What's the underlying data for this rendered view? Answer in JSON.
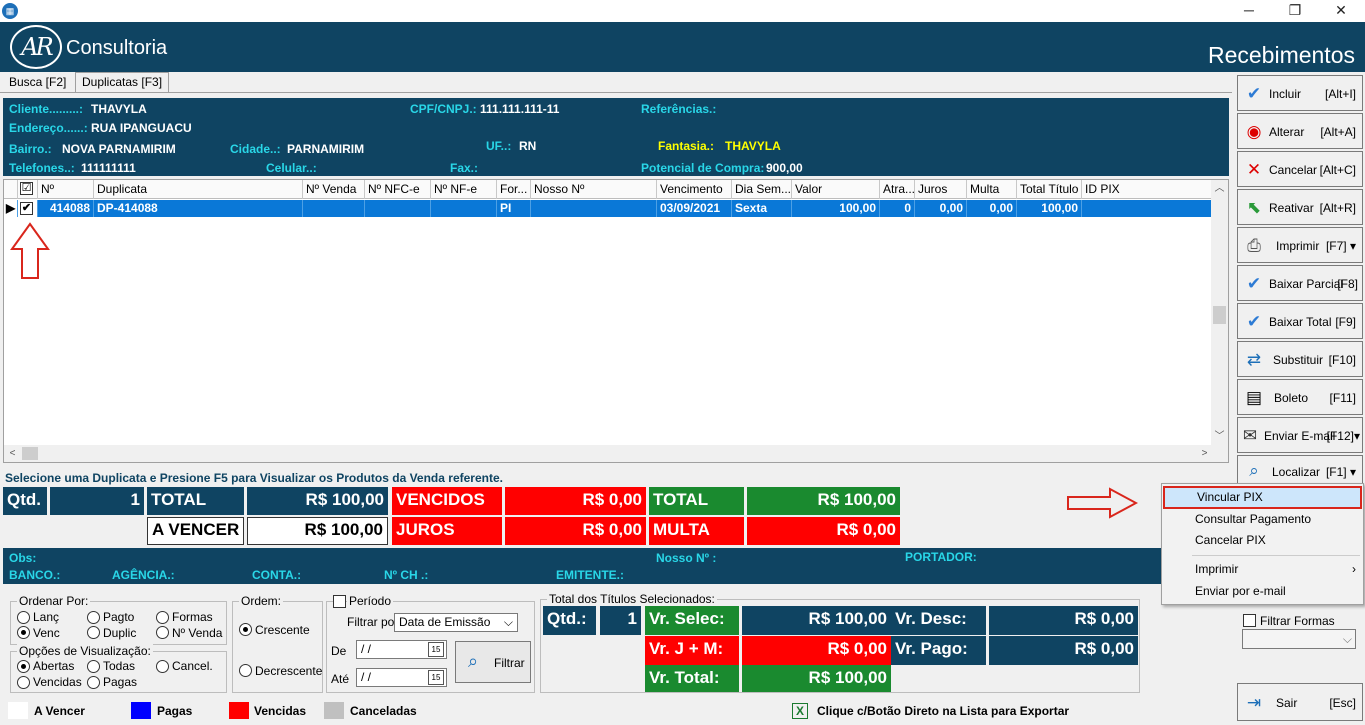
{
  "window": {
    "minimize": "─",
    "maximize": "❐",
    "close": "✕",
    "app_icon": "chart-icon"
  },
  "header": {
    "logo": "AR",
    "brand": "Consultoria",
    "title": "Recebimentos"
  },
  "tabs": [
    {
      "label": "Busca [F2]"
    },
    {
      "label": "Duplicatas [F3]"
    }
  ],
  "client": {
    "cliente_label": "Cliente.........:",
    "cliente": "THAVYLA",
    "cpf_label": "CPF/CNPJ.:",
    "cpf": "111.111.111-11",
    "ref_label": "Referências.:",
    "endereco_label": "Endereço......:",
    "endereco": "RUA IPANGUACU",
    "bairro_label": "Bairro.:",
    "bairro": "NOVA PARNAMIRIM",
    "cidade_label": "Cidade..:",
    "cidade": "PARNAMIRIM",
    "uf_label": "UF..:",
    "uf": "RN",
    "fantasia_label": "Fantasia.:",
    "fantasia": "THAVYLA",
    "telefones_label": "Telefones..:",
    "telefones": "111111111",
    "celular_label": "Celular..:",
    "fax_label": "Fax.:",
    "potencial_label": "Potencial de Compra:",
    "potencial": "900,00"
  },
  "grid": {
    "columns": [
      "Nº",
      "Duplicata",
      "Nº Venda",
      "Nº NFC-e",
      "Nº NF-e",
      "For...",
      "Nosso Nº",
      "Vencimento",
      "Dia Sem...",
      "Valor",
      "Atra...",
      "Juros",
      "Multa",
      "Total Título",
      "ID PIX"
    ],
    "row": {
      "checked": "✔",
      "num": "414088",
      "duplicata": "DP-414088",
      "venda": "",
      "nfce": "",
      "nfe": "",
      "forma": "PI",
      "nosso": "",
      "vencimento": "03/09/2021",
      "dia": "Sexta",
      "valor": "100,00",
      "atraso": "0",
      "juros": "0,00",
      "multa": "0,00",
      "total": "100,00",
      "pix": ""
    }
  },
  "actions": [
    {
      "label": "Incluir",
      "key": "[Alt+I]",
      "icon": "check-icon"
    },
    {
      "label": "Alterar",
      "key": "[Alt+A]",
      "icon": "edit-icon"
    },
    {
      "label": "Cancelar",
      "key": "[Alt+C]",
      "icon": "x-icon"
    },
    {
      "label": "Reativar",
      "key": "[Alt+R]",
      "icon": "arrow-icon"
    },
    {
      "label": "Imprimir",
      "key": "[F7]",
      "icon": "printer-icon"
    },
    {
      "label": "Baixar Parcial",
      "key": "[F8]",
      "icon": "check-icon"
    },
    {
      "label": "Baixar Total",
      "key": "[F9]",
      "icon": "check-icon"
    },
    {
      "label": "Substituir",
      "key": "[F10]",
      "icon": "swap-icon"
    },
    {
      "label": "Boleto",
      "key": "[F11]",
      "icon": "barcode-icon"
    },
    {
      "label": "Enviar E-mail",
      "key": "[F12]",
      "icon": "email-icon"
    },
    {
      "label": "Localizar",
      "key": "[F1]",
      "icon": "search-icon"
    },
    {
      "label": "Sair",
      "key": "[Esc]",
      "icon": "exit-icon"
    }
  ],
  "hint": "Selecione uma Duplicata e Presione F5 para Visualizar os Produtos da Venda referente.",
  "totals": {
    "qtd_label": "Qtd.",
    "qtd": "1",
    "total_label": "TOTAL",
    "total": "R$ 100,00",
    "avencer_label": "A VENCER",
    "avencer": "R$ 100,00",
    "vencidos_label": "VENCIDOS",
    "vencidos": "R$ 0,00",
    "juros_label": "JUROS",
    "juros": "R$ 0,00",
    "total2_label": "TOTAL",
    "total2": "R$ 100,00",
    "multa_label": "MULTA",
    "multa": "R$ 0,00"
  },
  "obs": {
    "obs": "Obs:",
    "nosso": "Nosso Nº :",
    "portador": "PORTADOR:",
    "banco": "BANCO.:",
    "agencia": "AGÊNCIA.:",
    "conta": "CONTA.:",
    "nch": "Nº CH .:",
    "emitente": "EMITENTE.:"
  },
  "ordenar": {
    "title": "Ordenar Por:",
    "opts": [
      "Lanç",
      "Pagto",
      "Formas",
      "Venc",
      "Duplic",
      "Nº Venda"
    ]
  },
  "visual": {
    "title": "Opções de Visualização:",
    "opts": [
      "Abertas",
      "Todas",
      "Cancel.",
      "Vencidas",
      "Pagas"
    ]
  },
  "ordem": {
    "title": "Ordem:",
    "crescente": "Crescente",
    "decrescente": "Decrescente"
  },
  "periodo": {
    "title": "Período",
    "filtrar_por": "Filtrar por:",
    "filtro": "Data de Emissão",
    "de": "De",
    "ate": "Até",
    "de_val": "/ /",
    "ate_val": "/ /",
    "filtrar": "Filtrar"
  },
  "selecionados": {
    "title": "Total dos Títulos Selecionados:",
    "qtd_label": "Qtd.:",
    "qtd": "1",
    "selec_label": "Vr. Selec:",
    "selec": "R$ 100,00",
    "desc_label": "Vr. Desc:",
    "desc": "R$ 0,00",
    "jm_label": "Vr. J + M:",
    "jm": "R$ 0,00",
    "pago_label": "Vr. Pago:",
    "pago": "R$ 0,00",
    "total_label": "Vr. Total:",
    "total": "R$ 100,00"
  },
  "filtrar_formas": "Filtrar Formas",
  "legend": [
    {
      "label": "A Vencer",
      "color": "#ffffff"
    },
    {
      "label": "Pagas",
      "color": "#0000ff"
    },
    {
      "label": "Vencidas",
      "color": "#ff0000"
    },
    {
      "label": "Canceladas",
      "color": "#c0c0c0"
    }
  ],
  "export_hint": "Clique c/Botão Direto na Lista para Exportar",
  "context_menu": [
    "Vincular PIX",
    "Consultar Pagamento",
    "Cancelar PIX",
    "Imprimir",
    "Enviar por e-mail"
  ],
  "colors": {
    "brand": "#0f4462",
    "selection": "#0a78d7",
    "label": "#29d7e8"
  }
}
